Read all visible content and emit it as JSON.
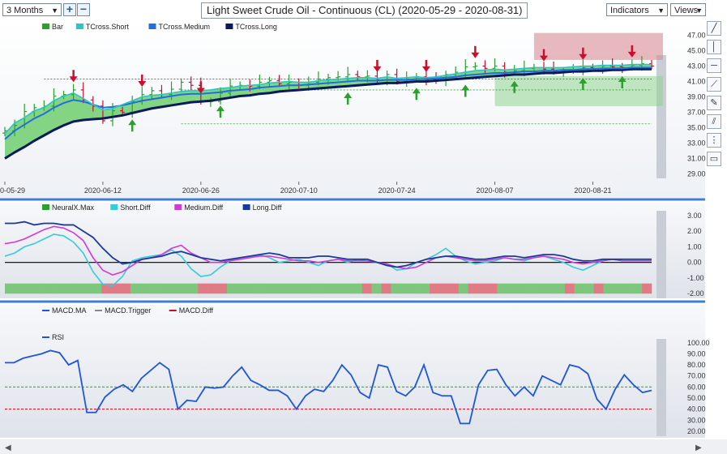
{
  "toolbar": {
    "period": "3 Months",
    "zoom_in": "+",
    "zoom_out": "−",
    "title": "Light Sweet Crude Oil - Continuous (CL) (2020-05-29 - 2020-08-31)",
    "indicators_label": "Indicators",
    "views_label": "Views"
  },
  "colors": {
    "up_bar": "#2e9e2e",
    "down_bar": "#c8102e",
    "tcross_short": "#2ec4c4",
    "tcross_medium": "#1f6fe0",
    "tcross_long": "#0a1a5a",
    "band_fill": "#6fcf6f",
    "short_diff": "#39c9d9",
    "medium_diff": "#d23ad2",
    "long_diff": "#1a3a9a",
    "rsi": "#1f56d6",
    "rsi_upper": "#36c236",
    "rsi_lower": "#d81f2f"
  },
  "chart_data": [
    {
      "type": "line",
      "panel": "price",
      "legend": [
        {
          "name": "Bar",
          "color": "#2e9e2e"
        },
        {
          "name": "TCross.Short",
          "color": "#2ec4c4"
        },
        {
          "name": "TCross.Medium",
          "color": "#1f6fe0"
        },
        {
          "name": "TCross.Long",
          "color": "#0a1a5a"
        }
      ],
      "x_tick_labels": [
        "0-05-29",
        "2020-06-12",
        "2020-06-26",
        "2020-07-10",
        "2020-07-24",
        "2020-08-07",
        "2020-08-21"
      ],
      "x_tick_index": [
        0,
        10,
        20,
        30,
        40,
        50,
        60
      ],
      "y_ticks": [
        29.0,
        31.0,
        33.0,
        35.0,
        37.0,
        39.0,
        41.0,
        43.0,
        45.0,
        47.0
      ],
      "ylim": [
        28.0,
        48.0
      ],
      "n_bars": 67,
      "close": [
        34.6,
        35.3,
        37.1,
        37.6,
        37.8,
        39.1,
        39.3,
        39.9,
        38.6,
        37.8,
        35.9,
        37.2,
        37.0,
        38.4,
        39.3,
        39.8,
        39.3,
        40.0,
        40.9,
        40.5,
        38.4,
        38.4,
        39.5,
        40.4,
        40.5,
        40.4,
        40.9,
        41.1,
        40.7,
        40.9,
        40.5,
        40.9,
        41.3,
        41.5,
        41.6,
        41.9,
        41.6,
        41.7,
        41.2,
        41.9,
        41.0,
        41.3,
        41.6,
        41.2,
        41.1,
        41.9,
        42.2,
        42.9,
        43.0,
        42.7,
        43.0,
        42.2,
        42.4,
        42.7,
        42.8,
        42.6,
        42.3,
        42.4,
        42.5,
        42.8,
        42.7,
        43.0,
        42.9,
        42.8,
        43.1,
        43.3,
        43.0
      ],
      "tcross_short": [
        34.2,
        35.6,
        36.3,
        37.2,
        37.6,
        38.5,
        39.1,
        39.5,
        38.8,
        38.0,
        37.3,
        37.5,
        38.0,
        38.5,
        39.0,
        39.2,
        39.3,
        39.5,
        39.7,
        39.8,
        39.8,
        39.9,
        40.1,
        40.2,
        40.4,
        40.5,
        40.6,
        40.8,
        40.9,
        41.0,
        40.9,
        40.9,
        41.1,
        41.2,
        41.3,
        41.4,
        41.5,
        41.5,
        41.4,
        41.6,
        41.4,
        41.5,
        41.6,
        41.5,
        41.6,
        41.8,
        42.0,
        42.2,
        42.4,
        42.5,
        42.6,
        42.5,
        42.6,
        42.7,
        42.8,
        42.8,
        42.8,
        42.8,
        42.9,
        43.0,
        43.0,
        43.1,
        43.1,
        43.1,
        43.2,
        43.2,
        43.2
      ],
      "tcross_medium": [
        33.5,
        34.6,
        35.4,
        36.2,
        36.8,
        37.6,
        38.2,
        38.6,
        38.4,
        38.0,
        37.6,
        37.7,
        37.9,
        38.2,
        38.5,
        38.7,
        38.9,
        39.1,
        39.3,
        39.4,
        39.4,
        39.5,
        39.6,
        39.8,
        39.9,
        40.0,
        40.2,
        40.3,
        40.4,
        40.5,
        40.5,
        40.6,
        40.7,
        40.8,
        40.9,
        41.0,
        41.1,
        41.1,
        41.1,
        41.2,
        41.2,
        41.2,
        41.3,
        41.3,
        41.4,
        41.5,
        41.6,
        41.8,
        41.9,
        42.0,
        42.1,
        42.1,
        42.2,
        42.3,
        42.3,
        42.4,
        42.4,
        42.5,
        42.5,
        42.6,
        42.6,
        42.7,
        42.7,
        42.7,
        42.8,
        42.8,
        42.8
      ],
      "tcross_long": [
        31.0,
        31.8,
        32.5,
        33.3,
        34.0,
        34.7,
        35.3,
        35.8,
        36.0,
        36.1,
        36.2,
        36.4,
        36.6,
        36.9,
        37.2,
        37.5,
        37.7,
        37.9,
        38.1,
        38.3,
        38.4,
        38.5,
        38.7,
        38.9,
        39.1,
        39.2,
        39.4,
        39.5,
        39.7,
        39.8,
        39.9,
        40.0,
        40.1,
        40.2,
        40.3,
        40.4,
        40.5,
        40.6,
        40.7,
        40.8,
        40.8,
        40.9,
        41.0,
        41.0,
        41.1,
        41.2,
        41.3,
        41.4,
        41.5,
        41.6,
        41.7,
        41.8,
        41.9,
        41.9,
        42.0,
        42.1,
        42.1,
        42.2,
        42.3,
        42.3,
        42.4,
        42.4,
        42.5,
        42.5,
        42.6,
        42.6,
        42.6
      ],
      "sell_signals": [
        7,
        14,
        20,
        38,
        43,
        48,
        55,
        59,
        64
      ],
      "buy_signals": [
        13,
        22,
        35,
        42,
        47,
        52,
        59,
        63
      ],
      "resistance_zone": {
        "from_index": 54,
        "y_low": 43.8,
        "y_high": 47.3
      },
      "support_zone": {
        "from_index": 50,
        "y_low": 37.8,
        "y_high": 41.7
      },
      "reference_levels": [
        41.3,
        39.9,
        35.5
      ]
    },
    {
      "type": "line",
      "panel": "neuralx",
      "legend": [
        {
          "name": "NeuralX.Max",
          "color": "#2e9e2e"
        },
        {
          "name": "Short.Diff",
          "color": "#39c9d9"
        },
        {
          "name": "Medium.Diff",
          "color": "#d23ad2"
        },
        {
          "name": "Long.Diff",
          "color": "#1a3a9a"
        }
      ],
      "y_ticks": [
        -2.0,
        -1.0,
        0.0,
        1.0,
        2.0,
        3.0
      ],
      "ylim": [
        -2.3,
        3.2
      ],
      "short_diff": [
        0.4,
        0.6,
        1.0,
        1.2,
        1.5,
        1.8,
        1.7,
        1.3,
        0.6,
        -0.6,
        -1.4,
        -1.5,
        -0.9,
        0.1,
        0.3,
        0.4,
        0.5,
        0.8,
        0.4,
        -0.4,
        -0.9,
        -0.8,
        -0.3,
        0.1,
        0.3,
        0.4,
        0.5,
        0.3,
        0.0,
        0.1,
        0.2,
        0.0,
        -0.2,
        0.1,
        0.2,
        0.0,
        0.2,
        0.1,
        0.0,
        -0.1,
        -0.5,
        -0.4,
        0.0,
        0.2,
        0.5,
        0.9,
        0.4,
        0.1,
        -0.1,
        0.0,
        0.1,
        0.3,
        0.2,
        0.1,
        0.3,
        0.4,
        0.2,
        0.0,
        -0.3,
        -0.5,
        -0.2,
        0.1,
        0.2,
        0.1,
        0.1,
        0.1,
        0.1
      ],
      "medium_diff": [
        1.2,
        1.3,
        1.5,
        1.8,
        2.1,
        2.3,
        2.2,
        1.9,
        1.4,
        0.3,
        -0.5,
        -0.8,
        -0.6,
        -0.2,
        0.2,
        0.3,
        0.5,
        0.9,
        1.1,
        0.6,
        0.3,
        0.0,
        0.0,
        0.1,
        0.2,
        0.3,
        0.4,
        0.4,
        0.3,
        0.2,
        0.1,
        0.1,
        0.0,
        0.1,
        0.2,
        0.1,
        0.1,
        0.1,
        0.0,
        -0.1,
        -0.3,
        -0.4,
        -0.3,
        0.0,
        0.3,
        0.4,
        0.3,
        0.2,
        0.1,
        0.1,
        0.2,
        0.3,
        0.2,
        0.2,
        0.3,
        0.4,
        0.3,
        0.2,
        0.0,
        -0.1,
        0.0,
        0.1,
        0.2,
        0.1,
        0.1,
        0.1,
        0.1
      ],
      "long_diff": [
        2.5,
        2.5,
        2.6,
        2.4,
        2.5,
        2.5,
        2.4,
        2.4,
        2.0,
        1.6,
        0.9,
        0.3,
        -0.1,
        0.0,
        0.2,
        0.3,
        0.4,
        0.6,
        0.7,
        0.5,
        0.3,
        0.2,
        0.1,
        0.2,
        0.3,
        0.4,
        0.5,
        0.6,
        0.5,
        0.3,
        0.3,
        0.3,
        0.4,
        0.4,
        0.3,
        0.2,
        0.2,
        0.2,
        0.0,
        -0.2,
        -0.3,
        -0.2,
        0.0,
        0.2,
        0.3,
        0.4,
        0.4,
        0.3,
        0.2,
        0.2,
        0.3,
        0.4,
        0.4,
        0.3,
        0.4,
        0.5,
        0.5,
        0.4,
        0.2,
        0.1,
        0.1,
        0.2,
        0.2,
        0.2,
        0.2,
        0.2,
        0.2
      ],
      "signal_bar": [
        "g",
        "g",
        "g",
        "g",
        "g",
        "g",
        "g",
        "g",
        "g",
        "g",
        "r",
        "r",
        "r",
        "g",
        "g",
        "g",
        "g",
        "g",
        "g",
        "g",
        "r",
        "r",
        "r",
        "g",
        "g",
        "g",
        "g",
        "g",
        "g",
        "g",
        "g",
        "g",
        "g",
        "g",
        "g",
        "g",
        "g",
        "r",
        "g",
        "r",
        "g",
        "g",
        "g",
        "g",
        "r",
        "r",
        "r",
        "g",
        "r",
        "r",
        "r",
        "g",
        "g",
        "g",
        "g",
        "g",
        "g",
        "g",
        "r",
        "g",
        "g",
        "r",
        "g",
        "g",
        "g",
        "g",
        "r"
      ]
    },
    {
      "type": "line",
      "panel": "macd",
      "legend": [
        {
          "name": "MACD.MA",
          "color": "#1f56d6"
        },
        {
          "name": "MACD.Trigger",
          "color": "#888888"
        },
        {
          "name": "MACD.Diff",
          "color": "#c8102e"
        }
      ]
    },
    {
      "type": "line",
      "panel": "rsi",
      "legend": [
        {
          "name": "RSI",
          "color": "#1f56d6"
        }
      ],
      "y_ticks": [
        20.0,
        30.0,
        40.0,
        50.0,
        60.0,
        70.0,
        80.0,
        90.0,
        100.0
      ],
      "ylim": [
        17,
        105
      ],
      "upper_level": 60,
      "lower_level": 40,
      "values": [
        82,
        82,
        86,
        88,
        90,
        93,
        91,
        80,
        84,
        37,
        37,
        51,
        58,
        62,
        56,
        68,
        75,
        82,
        76,
        40,
        48,
        47,
        60,
        59,
        60,
        70,
        78,
        66,
        62,
        57,
        57,
        52,
        40,
        52,
        58,
        56,
        66,
        80,
        71,
        55,
        50,
        80,
        78,
        56,
        52,
        60,
        80,
        55,
        52,
        52,
        27,
        27,
        62,
        75,
        76,
        62,
        52,
        60,
        52,
        70,
        66,
        62,
        80,
        78,
        72,
        49,
        40,
        58,
        71,
        62,
        55,
        57
      ]
    }
  ]
}
